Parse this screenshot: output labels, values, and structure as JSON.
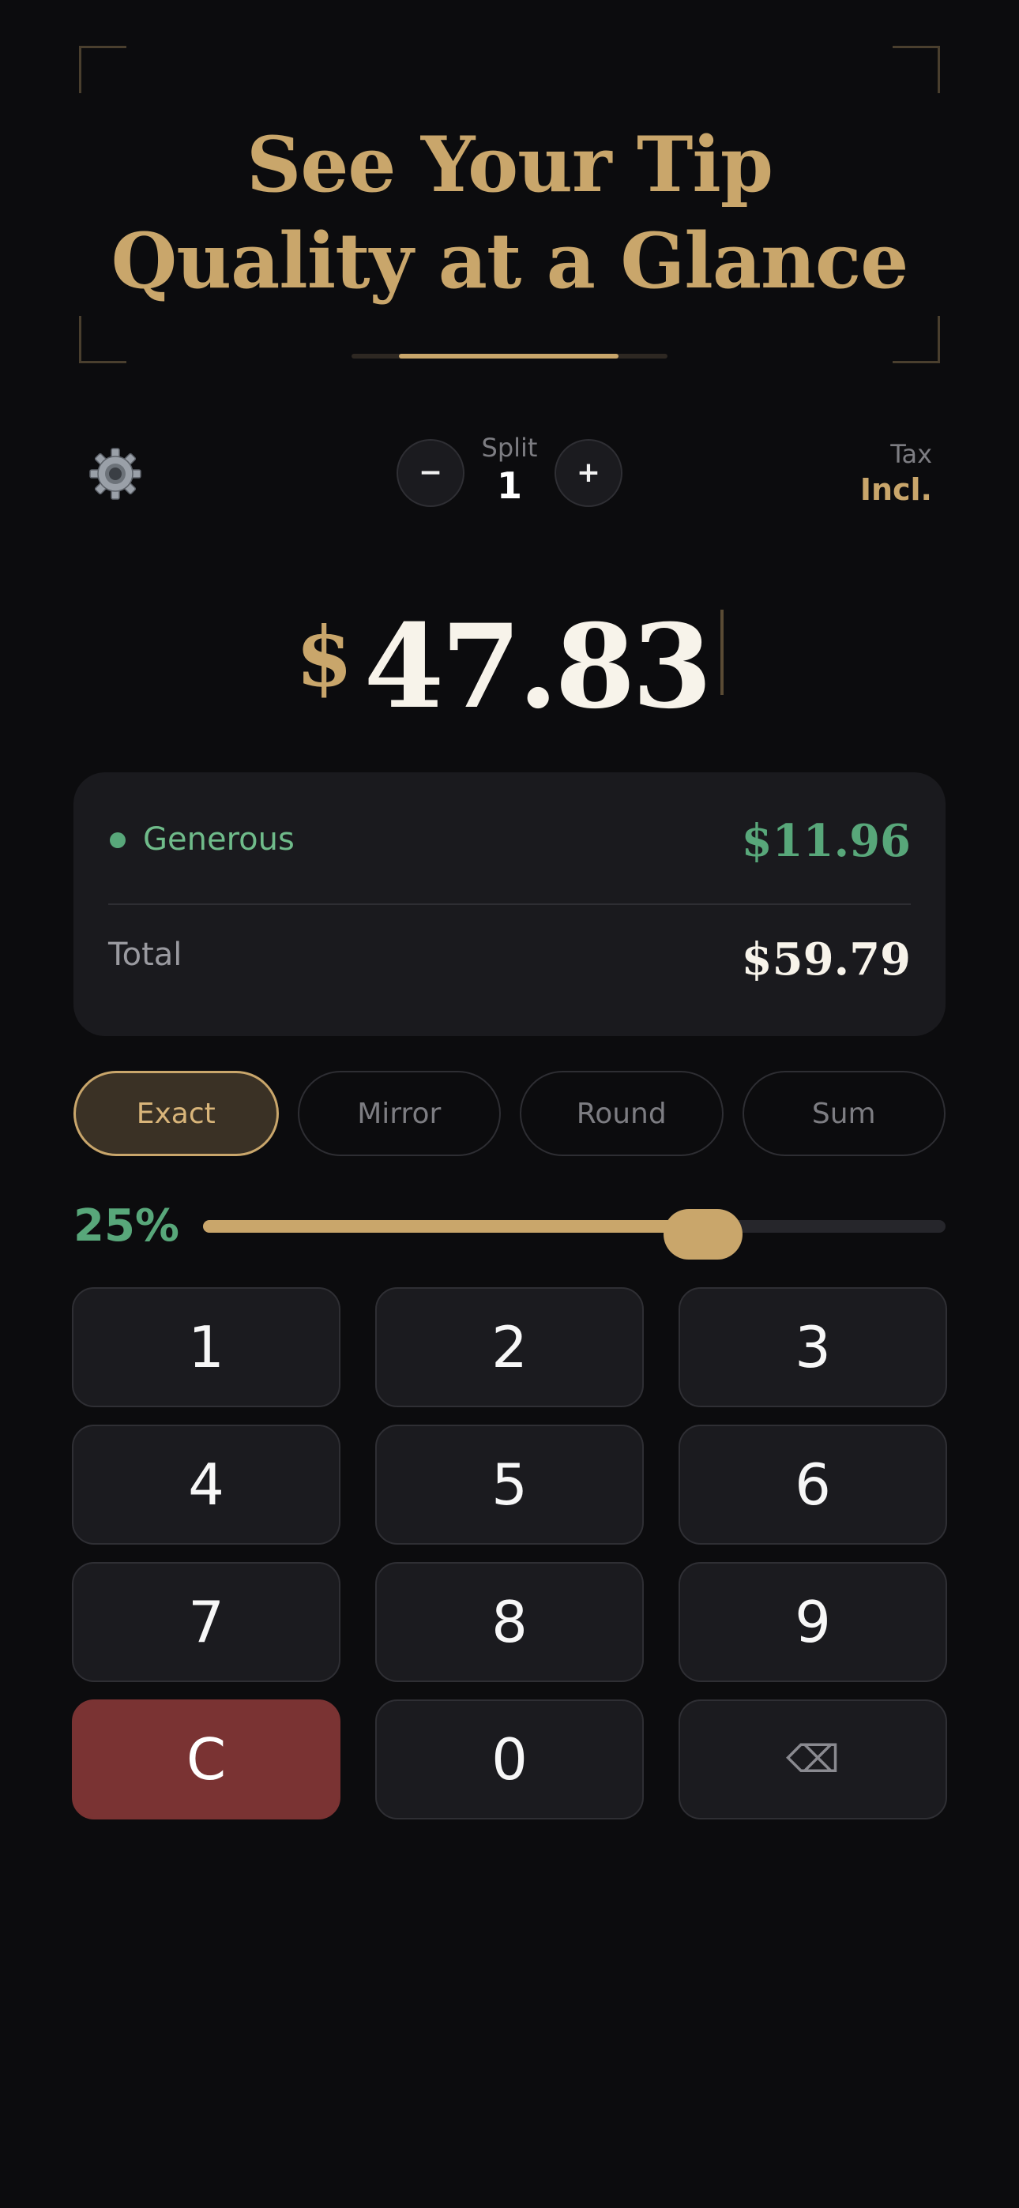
{
  "hero": {
    "title_line1": "See Your Tip",
    "title_line2": "Quality at a Glance",
    "progress": 0.7
  },
  "controls": {
    "settings_icon": "⚙️",
    "split_label": "Split",
    "split_value": "1",
    "minus_label": "−",
    "plus_label": "+",
    "tax_label": "Tax",
    "tax_value": "Incl."
  },
  "amount": {
    "currency": "$",
    "value": "47.83"
  },
  "result": {
    "rating": "Generous",
    "tip": "$11.96",
    "total_label": "Total",
    "total": "$59.79",
    "rating_color": "#58a77a"
  },
  "modes": [
    {
      "label": "Exact",
      "active": true
    },
    {
      "label": "Mirror",
      "active": false
    },
    {
      "label": "Round",
      "active": false
    },
    {
      "label": "Sum",
      "active": false
    }
  ],
  "slider": {
    "percent_label": "25%",
    "level": 0.62
  },
  "keypad": [
    {
      "label": "1",
      "kind": "digit"
    },
    {
      "label": "2",
      "kind": "digit"
    },
    {
      "label": "3",
      "kind": "digit"
    },
    {
      "label": "4",
      "kind": "digit"
    },
    {
      "label": "5",
      "kind": "digit"
    },
    {
      "label": "6",
      "kind": "digit"
    },
    {
      "label": "7",
      "kind": "digit"
    },
    {
      "label": "8",
      "kind": "digit"
    },
    {
      "label": "9",
      "kind": "digit"
    },
    {
      "label": "C",
      "kind": "clear"
    },
    {
      "label": "0",
      "kind": "digit"
    },
    {
      "label": "⌫",
      "kind": "back"
    }
  ],
  "colors": {
    "accent_gold": "#c9a66b",
    "accent_green": "#58a77a",
    "clear_red": "#7a3333",
    "background": "#0c0c0e"
  }
}
